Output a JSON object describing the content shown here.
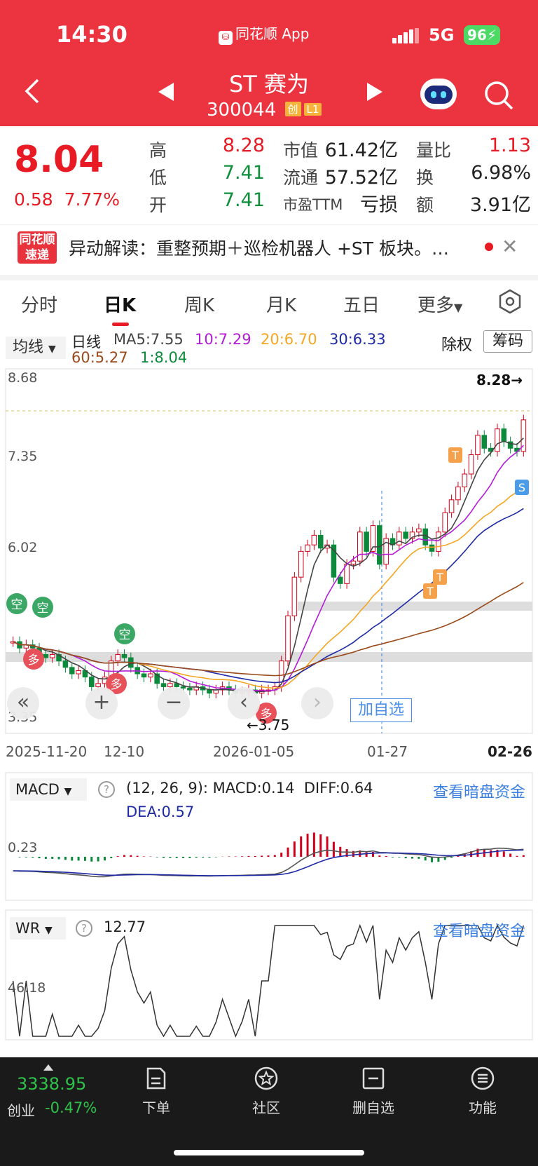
{
  "status": {
    "time": "14:30",
    "app": "同花顺 App",
    "network": "5G",
    "battery": "96"
  },
  "header": {
    "title": "ST 赛为",
    "code": "300044",
    "tag1": "创",
    "tag2": "L1"
  },
  "quote": {
    "price": "8.04",
    "change": "0.58",
    "change_pct": "7.77%",
    "high_label": "高",
    "high": "8.28",
    "low_label": "低",
    "low": "7.41",
    "open_label": "开",
    "open": "7.41",
    "mcap_label": "市值",
    "mcap": "61.42亿",
    "float_label": "流通",
    "float": "57.52亿",
    "pe_label": "市盈TTM",
    "pe": "亏损",
    "vol_ratio_label": "量比",
    "vol_ratio": "1.13",
    "turnover_label": "换",
    "turnover": "6.98%",
    "amount_label": "额",
    "amount": "3.91亿"
  },
  "news": {
    "logo_line1": "同花顺",
    "logo_line2": "速递",
    "text": "异动解读：重整预期＋巡检机器人 +ST 板块。…"
  },
  "tabs": [
    "分时",
    "日K",
    "周K",
    "月K",
    "五日",
    "更多"
  ],
  "chart": {
    "ma_button": "均线",
    "period": "日线",
    "ma5": "MA5:7.55",
    "ma10": "10:7.29",
    "ma20": "20:6.70",
    "ma30": "30:6.33",
    "ma60": "60:5.27",
    "ma1": "1:8.04",
    "adjust": "除权",
    "chips": "筹码",
    "y_labels": [
      "8.68",
      "7.35",
      "6.02",
      "3.35"
    ],
    "high_mark": "8.28→",
    "low_mark": "←3.75",
    "dates": [
      "2025-11-20",
      "12-10",
      "2026-01-05",
      "01-27",
      "02-26"
    ],
    "add_watch": "加自选",
    "badges": {
      "kong": "空",
      "duo": "多",
      "sell": "S",
      "t": "T"
    },
    "colors": {
      "ma5": "#444444",
      "ma10": "#b31bd8",
      "ma20": "#f5a623",
      "ma30": "#1f2aa6",
      "ma60": "#9b4a1b",
      "up": "#d0021b",
      "down": "#0a8a3a"
    }
  },
  "chart_data": {
    "type": "candlestick",
    "title": "ST 赛为 日线",
    "ylim": [
      3.35,
      8.68
    ],
    "dates_shown": [
      "2025-11-20",
      "12-10",
      "2026-01-05",
      "01-27",
      "02-26"
    ],
    "close_approx": [
      4.6,
      4.5,
      4.55,
      4.5,
      4.4,
      4.35,
      4.4,
      4.3,
      4.2,
      4.1,
      4.15,
      4.05,
      3.9,
      3.95,
      4.05,
      4.3,
      4.4,
      4.35,
      4.2,
      4.1,
      4.05,
      4.1,
      3.95,
      3.9,
      3.95,
      3.9,
      3.88,
      3.85,
      3.9,
      3.85,
      3.8,
      3.85,
      3.9,
      3.85,
      3.8,
      3.82,
      3.85,
      3.8,
      3.85,
      3.85,
      3.9,
      4.3,
      5.0,
      5.6,
      6.0,
      6.1,
      6.25,
      6.05,
      6.1,
      5.6,
      5.5,
      5.8,
      5.85,
      6.3,
      6.0,
      6.4,
      5.8,
      6.2,
      6.1,
      6.3,
      6.2,
      6.3,
      6.35,
      6.1,
      6.0,
      6.3,
      6.6,
      6.8,
      7.0,
      7.2,
      7.5,
      7.8,
      7.6,
      7.55,
      7.9,
      7.7,
      7.6,
      7.55,
      8.04
    ],
    "high": 8.28,
    "low": 3.75,
    "last": 8.04
  },
  "macd": {
    "label": "MACD",
    "params": "(12, 26, 9):",
    "macd": "MACD:0.14",
    "diff": "DIFF:0.64",
    "dea": "DEA:0.57",
    "y_label": "0.23",
    "link": "查看暗盘资金"
  },
  "wr": {
    "label": "WR",
    "value": "12.77",
    "y_label": "46.18",
    "link": "查看暗盘资金"
  },
  "bottom": {
    "index_value": "3338.95",
    "index_name": "创业",
    "index_change": "-0.47%",
    "nav": [
      "下单",
      "社区",
      "删自选",
      "功能"
    ]
  }
}
